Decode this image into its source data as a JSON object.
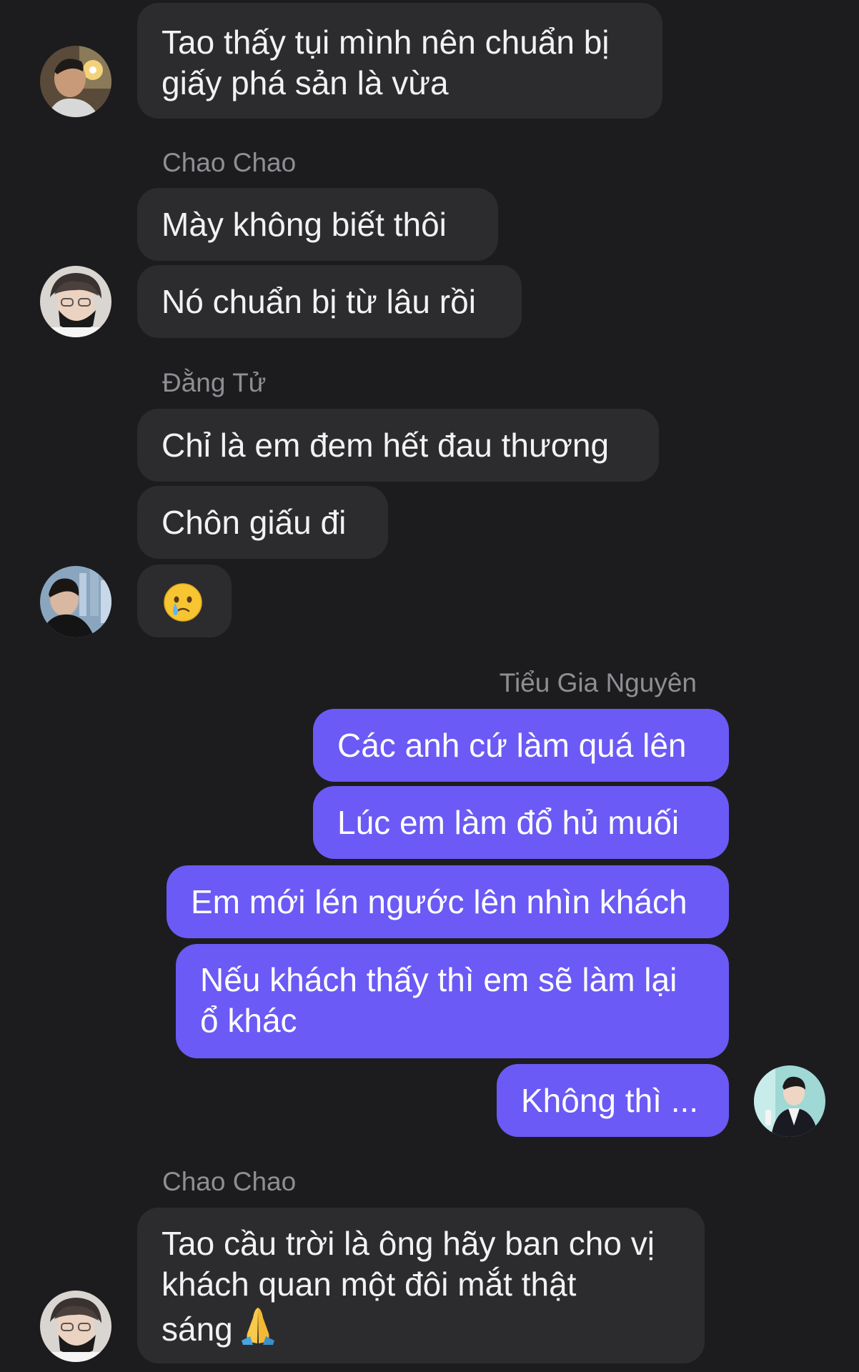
{
  "messages": {
    "m1": "Tao thấy tụi mình nên chuẩn bị\ngiấy phá sản là vừa",
    "sender_chao_1": "Chao Chao",
    "m2": "Mày không biết thôi",
    "m3": "Nó chuẩn bị từ lâu rồi",
    "sender_dang_tu": "Đằng Tử",
    "m4": "Chỉ là em đem hết đau thương",
    "m5": "Chôn giấu đi",
    "sender_tieu_gia": "Tiểu Gia Nguyên",
    "m6": "Các anh cứ làm quá lên",
    "m7": "Lúc em làm đổ hủ muối",
    "m8": "Em mới lén ngước lên nhìn khách",
    "m9": "Nếu khách thấy thì em sẽ làm lại\nổ khác",
    "m10": "Không thì ...",
    "sender_chao_2": "Chao Chao",
    "m11": "Tao cầu trời là ông hãy ban cho vị\nkhách quan một đôi mắt thật\nsáng"
  },
  "emojis": {
    "crying_face": "face-holding-back-tears-emoji",
    "folded_hands": "folded-hands-emoji"
  },
  "colors": {
    "background": "#1c1c1e",
    "incoming_bubble": "#2c2c2e",
    "outgoing_bubble": "#6b5af5",
    "sender_name": "#8e8e93"
  }
}
